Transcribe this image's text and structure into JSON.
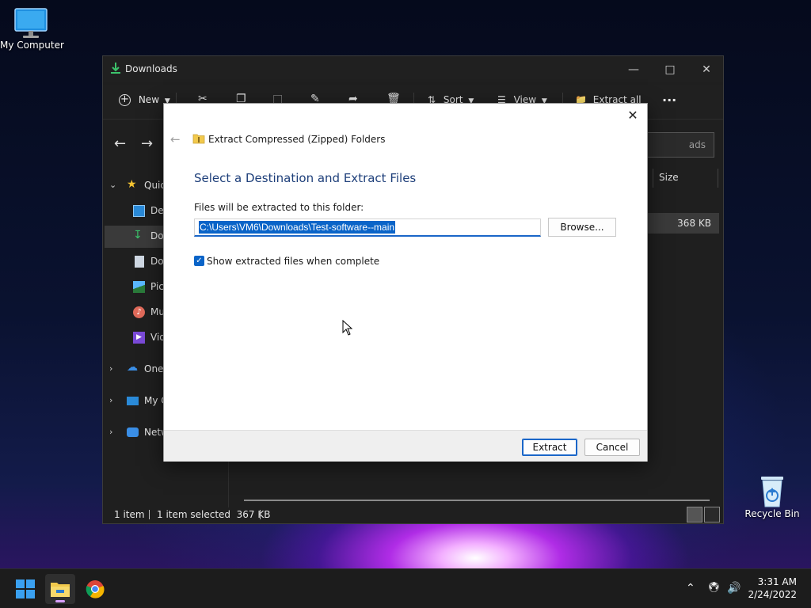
{
  "desktop": {
    "my_computer_label": "My Computer",
    "recycle_bin_label": "Recycle Bin"
  },
  "explorer": {
    "title": "Downloads",
    "toolbar": {
      "new_label": "New",
      "sort_label": "Sort",
      "view_label": "View",
      "extract_all_label": "Extract all",
      "more_label": "..."
    },
    "search_placeholder": "ads",
    "columns": {
      "size": "Size"
    },
    "sidebar": {
      "items": [
        {
          "label": "Quic",
          "icon": "star-icon"
        },
        {
          "label": "Des",
          "icon": "desktop-icon"
        },
        {
          "label": "Dov",
          "icon": "download-icon"
        },
        {
          "label": "Doc",
          "icon": "document-icon"
        },
        {
          "label": "Pict",
          "icon": "pictures-icon"
        },
        {
          "label": "Mu",
          "icon": "music-icon"
        },
        {
          "label": "Vid",
          "icon": "video-icon"
        },
        {
          "label": "OneI",
          "icon": "cloud-icon"
        },
        {
          "label": "My C",
          "icon": "computer-icon"
        },
        {
          "label": "Netw",
          "icon": "network-icon"
        }
      ]
    },
    "file_row": {
      "size": "368 KB"
    },
    "status": {
      "count": "1 item",
      "selection": "1 item selected  367 KB"
    }
  },
  "dialog": {
    "title": "Extract Compressed (Zipped) Folders",
    "heading": "Select a Destination and Extract Files",
    "label": "Files will be extracted to this folder:",
    "path_value": "C:\\Users\\VM6\\Downloads\\Test-software--main",
    "browse_label": "Browse...",
    "checkbox_label": "Show extracted files when complete",
    "checkbox_checked": true,
    "extract_label": "Extract",
    "cancel_label": "Cancel"
  },
  "taskbar": {
    "time": "3:31 AM",
    "date": "2/24/2022"
  },
  "colors": {
    "accent": "#0a64c8",
    "explorer_bg": "#1f1f1f",
    "heading_blue": "#1e3f7a"
  }
}
